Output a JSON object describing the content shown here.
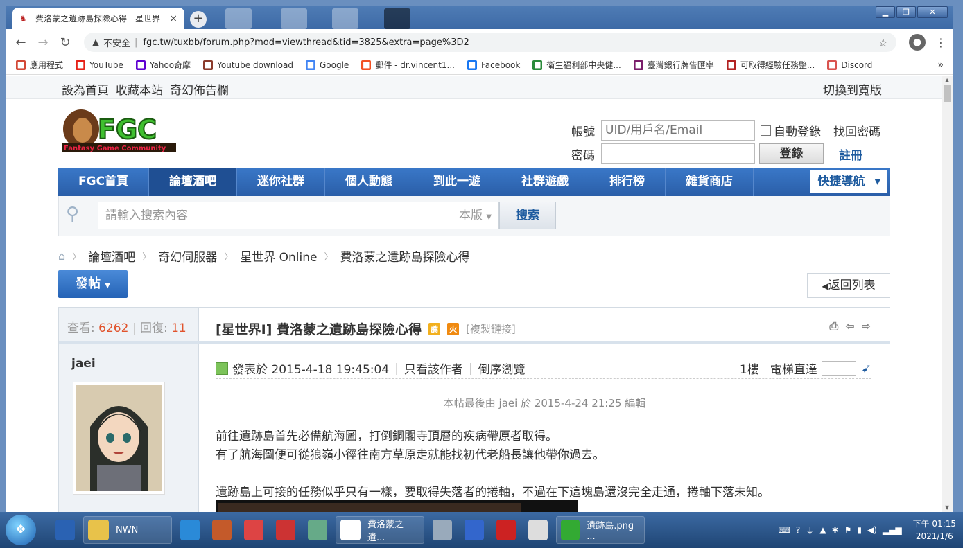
{
  "browser": {
    "tab_title": "費洛蒙之遺跡島探險心得 - 星世界",
    "tab_close": "×",
    "new_tab": "+",
    "insecure_label": "不安全",
    "url": "fgc.tw/tuxbb/forum.php?mod=viewthread&tid=3825&extra=page%3D2",
    "bookmarks": [
      {
        "label": "應用程式",
        "icon": "apps-grid-icon",
        "color": "#d34836"
      },
      {
        "label": "YouTube",
        "icon": "youtube-icon",
        "color": "#e62117"
      },
      {
        "label": "Yahoo奇摩",
        "icon": "yahoo-icon",
        "color": "#5f01d1"
      },
      {
        "label": "Youtube download",
        "icon": "music-note-icon",
        "color": "#8b3a2b"
      },
      {
        "label": "Google",
        "icon": "google-icon",
        "color": "#4285f4"
      },
      {
        "label": "郵件 - dr.vincent1...",
        "icon": "office-icon",
        "color": "#f25022"
      },
      {
        "label": "Facebook",
        "icon": "facebook-icon",
        "color": "#1877f2"
      },
      {
        "label": "衛生福利部中央健...",
        "icon": "nhi-icon",
        "color": "#2a8a3a"
      },
      {
        "label": "臺灣銀行牌告匯率",
        "icon": "bank-icon",
        "color": "#7a1d6a"
      },
      {
        "label": "可取得經驗任務整...",
        "icon": "fgc-icon",
        "color": "#b22222"
      },
      {
        "label": "Discord",
        "icon": "discord-icon",
        "color": "#d9534f"
      }
    ],
    "bookmarks_more": "»"
  },
  "site": {
    "top_links": [
      "設為首頁",
      "收藏本站",
      "奇幻佈告欄"
    ],
    "wide_switch": "切換到寬版",
    "logo_text": "FGC",
    "logo_sub": "Fantasy Game Community",
    "login": {
      "account_label": "帳號",
      "account_placeholder": "UID/用戶名/Email",
      "auto_login": "自動登錄",
      "forgot": "找回密碼",
      "password_label": "密碼",
      "login_button": "登錄",
      "register": "註冊"
    },
    "nav": [
      "FGC首頁",
      "論壇酒吧",
      "迷你社群",
      "個人動態",
      "到此一遊",
      "社群遊戲",
      "排行榜",
      "雜貨商店"
    ],
    "nav_active_index": 1,
    "quick_nav": "快捷導航",
    "search": {
      "placeholder": "請輸入搜索內容",
      "scope": "本版",
      "button": "搜索"
    },
    "breadcrumb": [
      "論壇酒吧",
      "奇幻伺服器",
      "星世界 Online",
      "費洛蒙之遺跡島探險心得"
    ],
    "post_button": "發帖",
    "back_button": "返回列表"
  },
  "thread": {
    "views_label": "查看:",
    "views": "6262",
    "replies_label": "回復:",
    "replies": "11",
    "title": "[星世界I] 費洛蒙之遺跡島探險心得",
    "badge_recommend": "薦",
    "badge_hot": "火",
    "copy_link": "[複製鏈接]",
    "author": "jaei",
    "posted": "發表於 2015-4-18 19:45:04",
    "only_author": "只看該作者",
    "reverse": "倒序瀏覽",
    "floor": "1樓",
    "elevator": "電梯直達",
    "edited": "本帖最後由 jaei 於 2015-4-24 21:25 編輯",
    "body": [
      "前往遺跡島首先必備航海圖，打倒銅閣寺頂層的疾病帶原者取得。",
      "有了航海圖便可從狼嶺小徑往南方草原走就能找初代老船長讓他帶你過去。",
      "",
      "遺跡島上可接的任務似乎只有一樣，要取得失落者的捲軸，不過在下這塊島還沒完全走通，捲軸下落未知。"
    ]
  },
  "taskbar": {
    "items": [
      {
        "label": "",
        "icon": "tamis-icon"
      },
      {
        "label": "NWN",
        "icon": "folder-icon"
      },
      {
        "label": "",
        "icon": "ie-icon"
      },
      {
        "label": "",
        "icon": "media-player-icon"
      },
      {
        "label": "",
        "icon": "cake-icon"
      },
      {
        "label": "",
        "icon": "recycle-icon"
      },
      {
        "label": "",
        "icon": "control-panel-icon"
      },
      {
        "label": "費洛蒙之遺...",
        "icon": "chrome-icon"
      },
      {
        "label": "",
        "icon": "notebook-icon"
      },
      {
        "label": "",
        "icon": "sync-icon"
      },
      {
        "label": "",
        "icon": "stopwatch-icon"
      },
      {
        "label": "",
        "icon": "calculator-icon"
      },
      {
        "label": "遺跡島.png ...",
        "icon": "image-viewer-icon"
      }
    ],
    "time": "下午 01:15",
    "date": "2021/1/6"
  }
}
